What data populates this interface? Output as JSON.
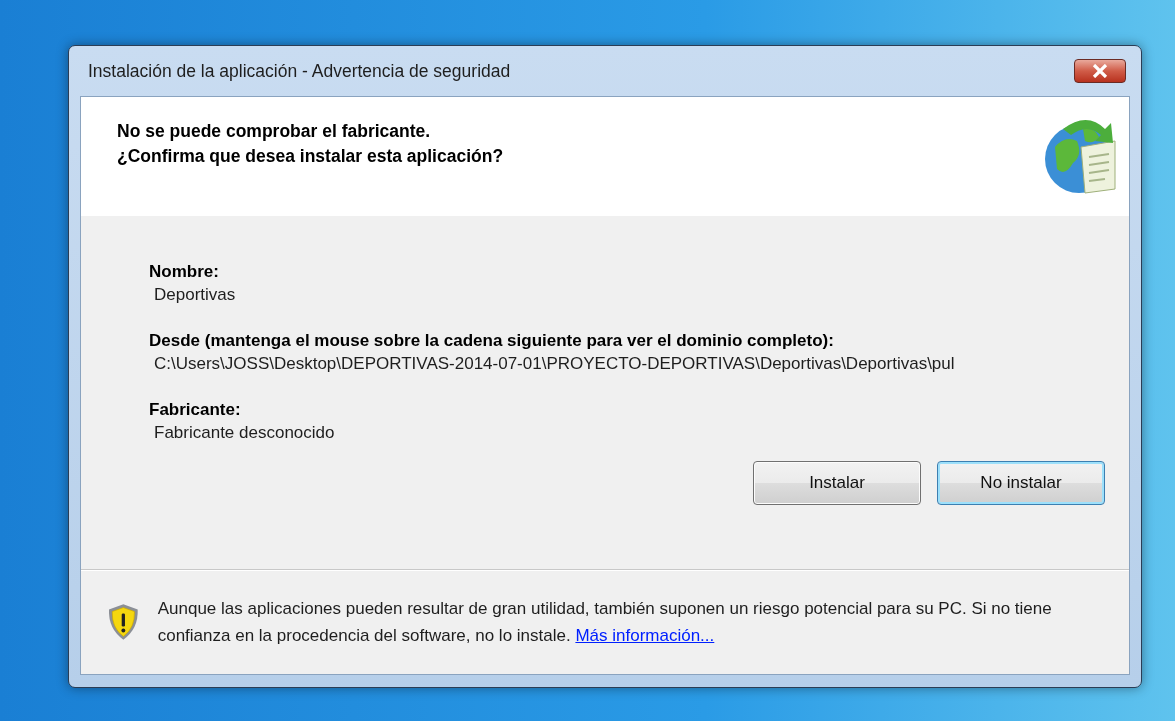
{
  "window": {
    "title": "Instalación de la aplicación - Advertencia de seguridad"
  },
  "header": {
    "lines": [
      "No se puede comprobar el fabricante.",
      "¿Confirma que desea instalar esta aplicación?"
    ]
  },
  "fields": [
    {
      "label": "Nombre:",
      "value": "Deportivas"
    },
    {
      "label": "Desde (mantenga el mouse sobre la cadena siguiente para ver el dominio completo):",
      "value": "C:\\Users\\JOSS\\Desktop\\DEPORTIVAS-2014-07-01\\PROYECTO-DEPORTIVAS\\Deportivas\\Deportivas\\pul"
    },
    {
      "label": "Fabricante:",
      "value": "Fabricante desconocido"
    }
  ],
  "buttons": [
    {
      "label": "Instalar",
      "default": false
    },
    {
      "label": "No instalar",
      "default": true
    }
  ],
  "footer": {
    "text": "Aunque las aplicaciones pueden resultar de gran utilidad, también suponen un riesgo potencial para su PC. Si no tiene confianza en la procedencia del software, no lo instale.",
    "link": "Más información..."
  }
}
